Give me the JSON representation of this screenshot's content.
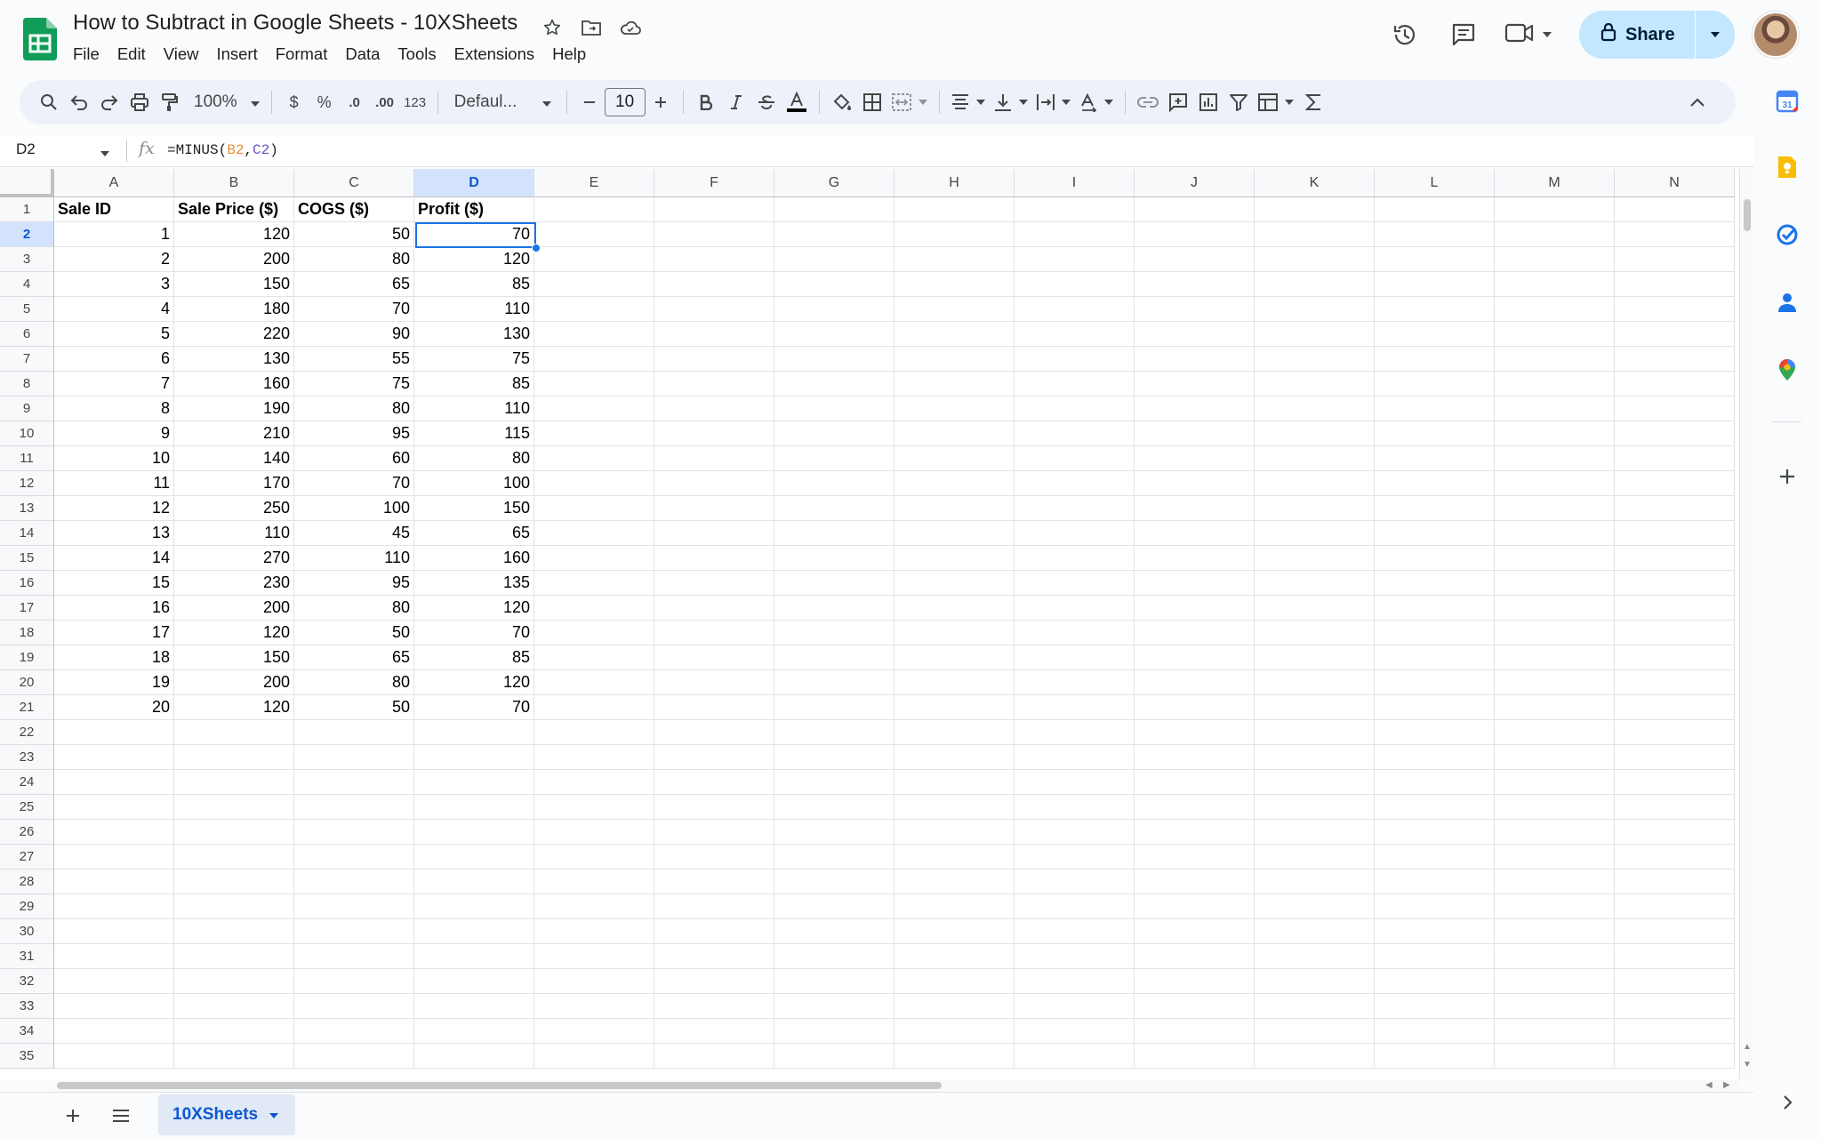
{
  "document": {
    "title": "How to Subtract in Google Sheets - 10XSheets"
  },
  "menu": [
    "File",
    "Edit",
    "View",
    "Insert",
    "Format",
    "Data",
    "Tools",
    "Extensions",
    "Help"
  ],
  "share": {
    "label": "Share"
  },
  "toolbar": {
    "zoom": "100%",
    "currency": "$",
    "percent": "%",
    "decrease_decimal": ".0",
    "increase_decimal": ".00",
    "number_format": "123",
    "font": "Defaul...",
    "font_size": "10"
  },
  "formula_bar": {
    "name_box": "D2",
    "formula_prefix": "=MINUS(",
    "ref1": "B2",
    "comma": ",",
    "ref2": "C2",
    "formula_suffix": ")"
  },
  "grid": {
    "columns": [
      "A",
      "B",
      "C",
      "D",
      "E",
      "F",
      "G",
      "H",
      "I",
      "J",
      "K",
      "L",
      "M",
      "N"
    ],
    "selected_column": "D",
    "selected_row": 2,
    "headers": [
      "Sale ID",
      "Sale Price ($)",
      "COGS ($)",
      "Profit ($)"
    ],
    "rows": [
      [
        1,
        120,
        50,
        70
      ],
      [
        2,
        200,
        80,
        120
      ],
      [
        3,
        150,
        65,
        85
      ],
      [
        4,
        180,
        70,
        110
      ],
      [
        5,
        220,
        90,
        130
      ],
      [
        6,
        130,
        55,
        75
      ],
      [
        7,
        160,
        75,
        85
      ],
      [
        8,
        190,
        80,
        110
      ],
      [
        9,
        210,
        95,
        115
      ],
      [
        10,
        140,
        60,
        80
      ],
      [
        11,
        170,
        70,
        100
      ],
      [
        12,
        250,
        100,
        150
      ],
      [
        13,
        110,
        45,
        65
      ],
      [
        14,
        270,
        110,
        160
      ],
      [
        15,
        230,
        95,
        135
      ],
      [
        16,
        200,
        80,
        120
      ],
      [
        17,
        120,
        50,
        70
      ],
      [
        18,
        150,
        65,
        85
      ],
      [
        19,
        200,
        80,
        120
      ],
      [
        20,
        120,
        50,
        70
      ]
    ],
    "visible_row_count": 35
  },
  "sheets": [
    {
      "name": "10XSheets",
      "active": true
    }
  ],
  "colors": {
    "accent": "#1a73e8",
    "share_bg": "#c2e7ff",
    "selected_header": "#d3e3fd",
    "sheets_green": "#0f9d58"
  }
}
